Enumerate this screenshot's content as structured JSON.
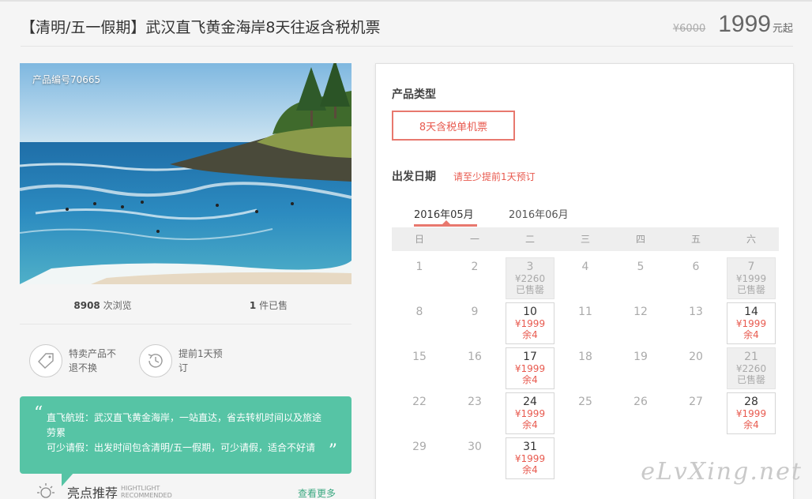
{
  "header": {
    "title": "【清明/五一假期】武汉直飞黄金海岸8天往返含税机票",
    "old_price": "¥6000",
    "price": "1999",
    "price_unit": "元起"
  },
  "photo": {
    "product_id": "产品编号70665"
  },
  "stats": {
    "views_count": "8908",
    "views_label": "次浏览",
    "sold_count": "1",
    "sold_label": "件已售"
  },
  "features": [
    {
      "icon": "tag-icon",
      "text": "特卖产品不退不换"
    },
    {
      "icon": "clock-history-icon",
      "text": "提前1天预订"
    }
  ],
  "description": {
    "line1": "直飞航班：武汉直飞黄金海岸，一站直达，省去转机时间以及旅途劳累",
    "line2": "可少请假：出发时间包含清明/五一假期，可少请假，适合不好请"
  },
  "highlights": {
    "title": "亮点推荐",
    "en_line1": "HIGHTLIGHT",
    "en_line2": "RECOMMENDED",
    "more": "查看更多"
  },
  "booking": {
    "type_label": "产品类型",
    "type_option": "8天含税单机票",
    "date_label": "出发日期",
    "date_hint": "请至少提前1天预订",
    "months": [
      "2016年05月",
      "2016年06月"
    ],
    "active_month": 0,
    "weekdays": [
      "日",
      "一",
      "二",
      "三",
      "四",
      "五",
      "六"
    ],
    "weeks": [
      [
        {
          "d": "1"
        },
        {
          "d": "2"
        },
        {
          "d": "3",
          "price": "¥2260",
          "status": "已售罄",
          "sold": true
        },
        {
          "d": "4"
        },
        {
          "d": "5"
        },
        {
          "d": "6"
        },
        {
          "d": "7",
          "price": "¥1999",
          "status": "已售罄",
          "sold": true
        }
      ],
      [
        {
          "d": "8"
        },
        {
          "d": "9"
        },
        {
          "d": "10",
          "price": "¥1999",
          "status": "余4"
        },
        {
          "d": "11"
        },
        {
          "d": "12"
        },
        {
          "d": "13"
        },
        {
          "d": "14",
          "price": "¥1999",
          "status": "余4"
        }
      ],
      [
        {
          "d": "15"
        },
        {
          "d": "16"
        },
        {
          "d": "17",
          "price": "¥1999",
          "status": "余4"
        },
        {
          "d": "18"
        },
        {
          "d": "19"
        },
        {
          "d": "20"
        },
        {
          "d": "21",
          "price": "¥2260",
          "status": "已售罄",
          "sold": true
        }
      ],
      [
        {
          "d": "22"
        },
        {
          "d": "23"
        },
        {
          "d": "24",
          "price": "¥1999",
          "status": "余4"
        },
        {
          "d": "25"
        },
        {
          "d": "26"
        },
        {
          "d": "27"
        },
        {
          "d": "28",
          "price": "¥1999",
          "status": "余4"
        }
      ],
      [
        {
          "d": "29"
        },
        {
          "d": "30"
        },
        {
          "d": "31",
          "price": "¥1999",
          "status": "余4"
        },
        null,
        null,
        null,
        null
      ]
    ]
  },
  "watermark": "eLvXing.net",
  "colors": {
    "accent": "#e85a4f",
    "green": "#56c4a5"
  }
}
